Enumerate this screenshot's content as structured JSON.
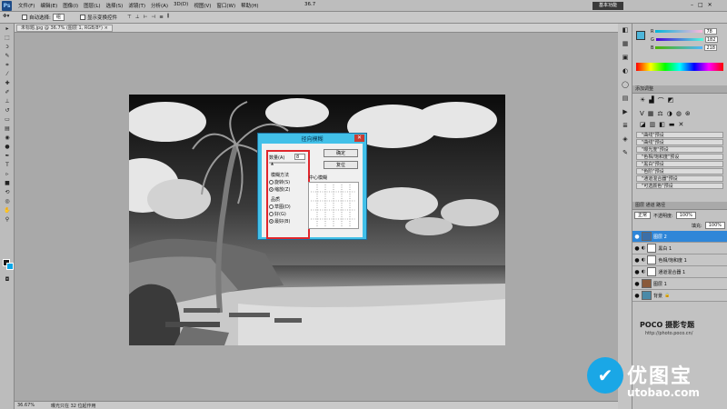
{
  "app": {
    "logo": "Ps",
    "menu": [
      "文件(F)",
      "编辑(E)",
      "图像(I)",
      "图层(L)",
      "选择(S)",
      "滤镜(T)",
      "分析(A)",
      "3D(D)",
      "视图(V)",
      "窗口(W)",
      "帮助(H)"
    ],
    "zoom_display": "36.7",
    "workspace_button": "基本功能",
    "window_buttons": [
      "–",
      "□",
      "✕"
    ]
  },
  "options_bar": {
    "auto_select_label": "自动选择:",
    "auto_select_value": "组",
    "show_transform_label": "显示变换控件"
  },
  "document": {
    "tab_label": "未标题.jpg @ 36.7% (图层 1, RGB/8*) ×",
    "status_zoom": "36.67%",
    "status_text": "曝光只在 32 位起作用"
  },
  "dialog": {
    "title": "径向模糊",
    "amount_label": "数量(A)",
    "amount_value": "8",
    "ok_label": "确定",
    "cancel_label": "复位",
    "blur_method_label": "模糊方法",
    "blur_methods": [
      "旋转(S)",
      "缩放(Z)"
    ],
    "selected_method": 1,
    "quality_label": "品质",
    "qualities": [
      "草图(D)",
      "好(G)",
      "最好(B)"
    ],
    "selected_quality": 2,
    "center_label": "中心模糊"
  },
  "panels": {
    "color": {
      "r": "78",
      "g": "182",
      "b": "218",
      "swatch": "#4eb6da"
    },
    "adjustments": {
      "title": "添加调整",
      "presets": [
        "\"曲线\"预设",
        "\"曲线\"预设",
        "\"曝光度\"预设",
        "\"色相/饱和度\"预设",
        "\"黑白\"预设",
        "\"色阶\"预设",
        "\"通道混合器\"预设",
        "\"可选颜色\"预设"
      ]
    },
    "layers": {
      "blend_mode": "正常",
      "opacity_label": "不透明度:",
      "opacity_value": "100%",
      "fill_label": "填充:",
      "fill_value": "100%",
      "items": [
        {
          "name": "图层 2",
          "active": true,
          "mask": false
        },
        {
          "name": "黑白 1",
          "active": false,
          "mask": true
        },
        {
          "name": "色相/饱和度 1",
          "active": false,
          "mask": true
        },
        {
          "name": "通道混合器 1",
          "active": false,
          "mask": true
        },
        {
          "name": "图层 1",
          "active": false,
          "mask": false
        },
        {
          "name": "背景",
          "active": false,
          "mask": false
        }
      ]
    }
  },
  "watermark": {
    "poco_title": "POCO 摄影专题",
    "poco_url": "http://photo.poco.cn/",
    "brand_cn": "优图宝",
    "brand_url": "utobao.com"
  },
  "colors": {
    "accent_blue": "#2f86d8",
    "dialog_frame": "#42c0e8",
    "highlight_red": "#e0262c"
  }
}
